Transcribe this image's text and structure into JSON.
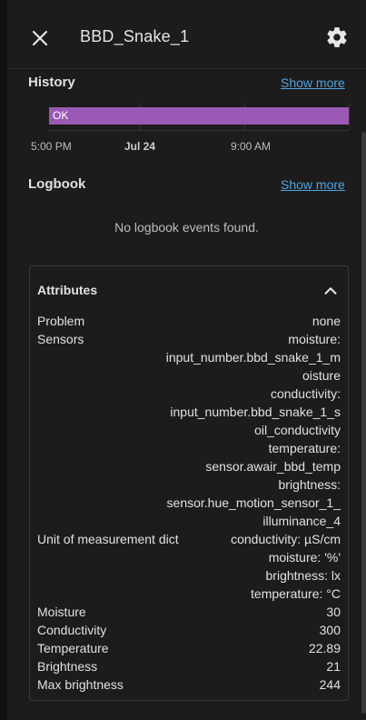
{
  "header": {
    "title": "BBD_Snake_1"
  },
  "history": {
    "title": "History",
    "show_more": "Show more",
    "state_label": "OK",
    "ticks": [
      "5:00 PM",
      "Jul 24",
      "9:00 AM"
    ],
    "bar_color": "#9b59b6"
  },
  "logbook": {
    "title": "Logbook",
    "show_more": "Show more",
    "empty_text": "No logbook events found."
  },
  "attributes": {
    "title": "Attributes",
    "rows": [
      {
        "key": "Problem",
        "value": "none"
      },
      {
        "key": "Sensors",
        "value": "moisture:\ninput_number.bbd_snake_1_m\noisture\nconductivity:\ninput_number.bbd_snake_1_s\noil_conductivity\ntemperature:\nsensor.awair_bbd_temp\nbrightness:\nsensor.hue_motion_sensor_1_\nilluminance_4"
      },
      {
        "key": "Unit of measurement dict",
        "value": "conductivity: µS/cm\nmoisture: '%'\nbrightness: lx\ntemperature: °C"
      },
      {
        "key": "Moisture",
        "value": "30"
      },
      {
        "key": "Conductivity",
        "value": "300"
      },
      {
        "key": "Temperature",
        "value": "22.89"
      },
      {
        "key": "Brightness",
        "value": "21"
      },
      {
        "key": "Max brightness",
        "value": "244"
      }
    ]
  },
  "colors": {
    "link": "#4fa3e0",
    "background": "#1c1c1c"
  }
}
